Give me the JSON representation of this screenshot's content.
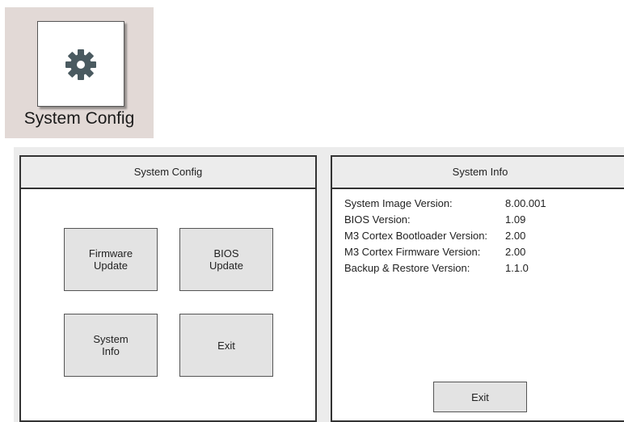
{
  "launcher": {
    "label": "System Config",
    "icon": "gear-icon"
  },
  "config_dialog": {
    "title": "System Config",
    "buttons": {
      "firmware_update": "Firmware\nUpdate",
      "bios_update": "BIOS\nUpdate",
      "system_info": "System\nInfo",
      "exit": "Exit"
    }
  },
  "info_dialog": {
    "title": "System Info",
    "rows": [
      {
        "key": "System Image Version:",
        "value": "8.00.001"
      },
      {
        "key": "BIOS Version:",
        "value": "1.09"
      },
      {
        "key": "M3 Cortex Bootloader Version:",
        "value": "2.00"
      },
      {
        "key": "M3 Cortex Firmware Version:",
        "value": "2.00"
      },
      {
        "key": "Backup & Restore Version:",
        "value": "1.1.0"
      }
    ],
    "exit_label": "Exit"
  },
  "colors": {
    "gear": "#4a5a60",
    "tile_bg": "#e2d9d6",
    "button_bg": "#e3e3e3"
  }
}
